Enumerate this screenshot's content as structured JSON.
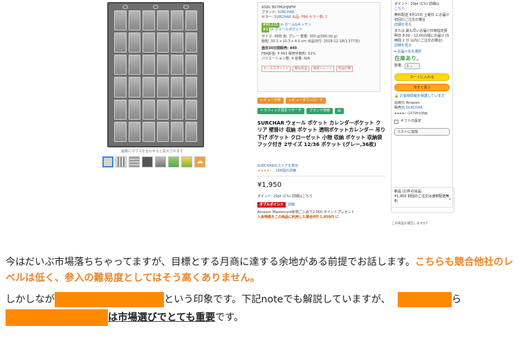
{
  "colors": {
    "accent_orange": "#e8862a",
    "redaction": "#ff8a00",
    "link_blue": "#2a6fb0",
    "stock_green": "#007600",
    "cart_yellow": "#ffd814",
    "buy_orange": "#ffa41c"
  },
  "product": {
    "image_caption": "画像にマウスを合わせると拡大されます",
    "info_lines": {
      "asin": "ASIN: B07MGHJNFM",
      "brand_label": "ブランド:",
      "brand": "SURCHAR",
      "seller_label": "セラー:",
      "seller": "SURCHAR",
      "fba_tag": "出品: FBA",
      "seller_count": "セラー数: 2",
      "rank1": "#96,115",
      "rank1_cat": "in ホーム&キッチン",
      "rank2": "#3",
      "rank2_cat": "in ウォールポケット",
      "size_line": "サイズ: 36枚    色: グレー    重量: 300 g(300.00 g)",
      "dims_line": "梱包: 30.1 x 15.3 x 4.5 cm    出品日付: 2018-12-18(1,577日)",
      "sales30": "過去30日間販売: 449",
      "fba_fee": "FBA料金: ¥ 463    販売手数料: 51%",
      "variations": "バリエーション数: 4    容量: N/A"
    },
    "info_badges": [
      "セールスポイント",
      "類似商品",
      "検索トレンド",
      "利益計算"
    ],
    "tool_buttons_row1": [
      "レビュー分析",
      "レビューダウンロード"
    ],
    "tool_buttons_row2": [
      "トラフィック源をリサーチ",
      "ブランド検索",
      "▤"
    ],
    "title": "SURCHAR ウォール ポケット カレンダーポケット クリア 壁掛け 収納 ポケット 透明ポケットカレンダー 吊り下げ ポケット クローゼット 小物 収納 ポケット 収納袋 フック付き 2サイズ 12/36 ポケット (グレー,36枚)",
    "store_link": "SURCHARのストアを表示",
    "stars": "★★★★☆",
    "ratings": "166個の評価",
    "price": "¥1,950",
    "points": "ポイント: 20pt  (1%)  詳細はこちら",
    "double_point": "ダブルポイント",
    "double_detail": "詳細",
    "card_line1": "Amazon Mastercard新規ご入会で2,000 ポイントプレゼント",
    "card_line2": "入会特典をこの商品に利用した場合0円 1,950円 に"
  },
  "buybox": {
    "points": "ポイント: 20pt  (1%)  詳細は",
    "points2": "こちら",
    "free_delivery": "無料配送  4月15日  土曜日 にお届け  初回のご注文の場合",
    "detail": "詳細を見る",
    "fastest": "または  最も早いお届け日時指定便  明日 8:00 - 12:00の間にお届け (9 時間 2 分 以内にご注文の場合)",
    "detail2": "詳細を見る",
    "address": "お届け先を選択",
    "stock": "在庫あり。",
    "qty_label": "数量:",
    "qty_value": "1",
    "cart_button": "カートに入れる",
    "buy_button": "今すぐ買う",
    "secure": "お客様情報を保護しています",
    "ship_from_label": "出荷元",
    "ship_from": "Amazon",
    "seller_label": "販売元",
    "seller": "SURCHAR",
    "seller_rating": "★★★★☆ (2475件の評価)",
    "gift": "ギフトの設定",
    "add_list": "リストに追加",
    "others_line1": "新品 (2)件の出品：",
    "others_line2": "¥1,950  初回のご注文は通常配送無料",
    "report": "この商品を報告しますか？"
  },
  "article": {
    "para1_normal": "今はだいぶ市場落ちちゃってますが、目標とする月商に達する余地がある前提でお話します。",
    "para1_orange": "こちらも競合他社のレベルは低く、参入の難易度としてはそう高くありません。",
    "para2_start": "しかしなが",
    "para2_mid": "という印象です。下記noteでも解説していますが、",
    "para2_tail": "ら",
    "para3_bold": "は市場選びでとても重要",
    "para3_end": "です。"
  }
}
